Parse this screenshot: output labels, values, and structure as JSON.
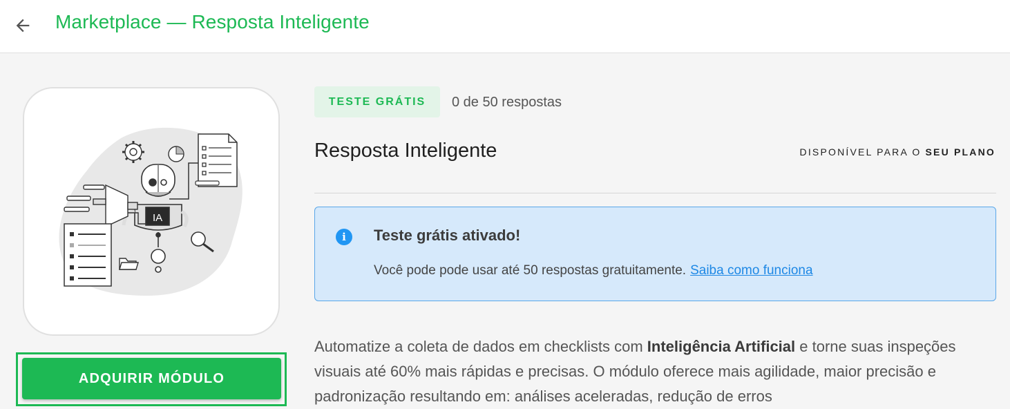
{
  "header": {
    "back_icon": "arrow-left-icon",
    "title": "Marketplace — Resposta Inteligente"
  },
  "illustration": {
    "robot_label": "IA",
    "icons": [
      "gear-icon",
      "clock-icon",
      "document-icon",
      "checklist-icon",
      "folder-icon",
      "magnifier-icon",
      "robot-icon"
    ]
  },
  "actions": {
    "acquire_label": "ADQUIRIR MÓDULO"
  },
  "trial": {
    "badge": "TESTE GRÁTIS",
    "usage": "0 de 50 respostas"
  },
  "module": {
    "title": "Resposta Inteligente",
    "availability_prefix": "DISPONÍVEL PARA O",
    "availability_plan": "SEU PLANO"
  },
  "info": {
    "icon": "info-icon",
    "title": "Teste grátis ativado!",
    "text": "Você pode pode usar até 50 respostas gratuitamente.",
    "link": "Saiba como funciona"
  },
  "description": {
    "part1": "Automatize a coleta de dados em checklists com ",
    "bold": "Inteligência Artificial",
    "part2": " e torne suas inspeções visuais até 60% mais rápidas e precisas. O módulo oferece mais agilidade, maior precisão e padronização resultando em: análises aceleradas, redução de erros"
  },
  "colors": {
    "brand_green": "#1db954",
    "badge_bg": "#e3f4e8",
    "info_bg": "#d6e9fb",
    "info_border": "#5aa7e8",
    "link_blue": "#1e88e5"
  }
}
